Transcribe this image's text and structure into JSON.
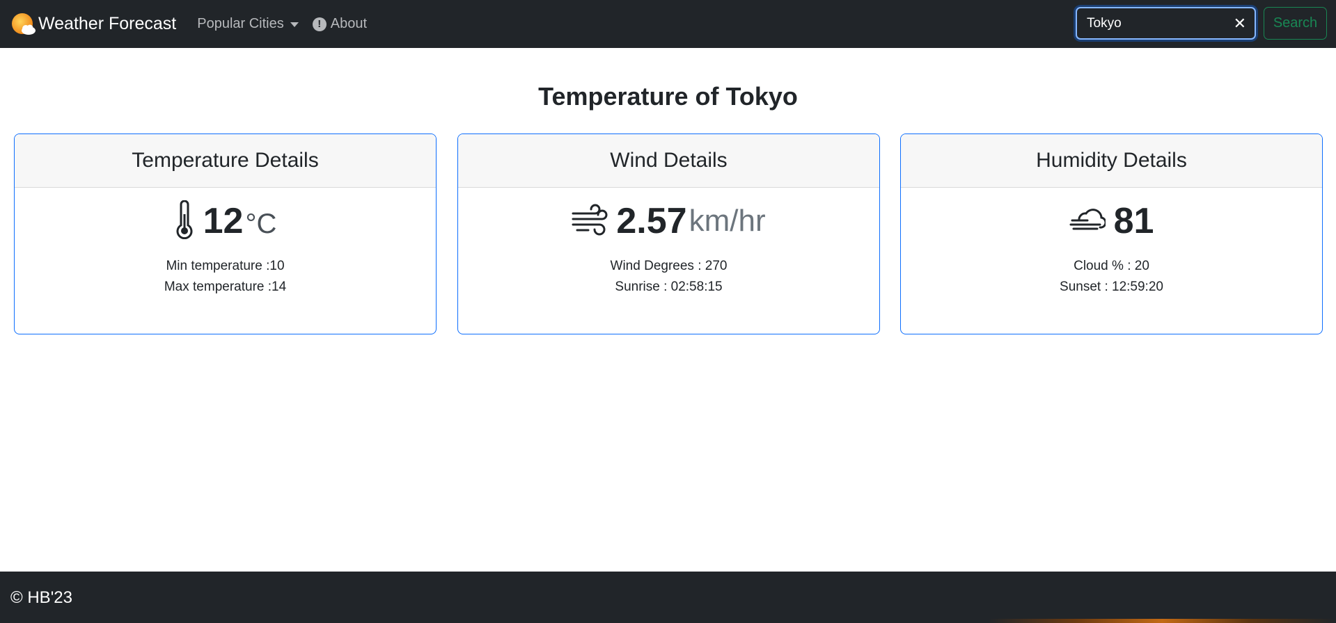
{
  "nav": {
    "brand": "Weather Forecast",
    "popular_cities": "Popular Cities",
    "about": "About",
    "info_glyph": "!",
    "search": {
      "value": "Tokyo",
      "clear": "✕",
      "button": "Search"
    }
  },
  "main": {
    "title": "Temperature of Tokyo",
    "cards": [
      {
        "header": "Temperature Details",
        "icon": "thermometer-icon",
        "value": "12",
        "unit": "°C",
        "lines": [
          "Min temperature :10",
          "Max temperature :14"
        ]
      },
      {
        "header": "Wind Details",
        "icon": "wind-icon",
        "value": "2.57",
        "unit": "km/hr",
        "lines": [
          "Wind Degrees : 270",
          "Sunrise : 02:58:15"
        ]
      },
      {
        "header": "Humidity Details",
        "icon": "haze-cloud-icon",
        "value": "81",
        "unit": "",
        "lines": [
          "Cloud % : 20",
          "Sunset : 12:59:20"
        ]
      }
    ]
  },
  "footer": {
    "text": "© HB'23"
  },
  "colors": {
    "navbar": "#212529",
    "card_border": "#0d6efd",
    "search_button": "#198754",
    "sun": "#f5a623"
  }
}
